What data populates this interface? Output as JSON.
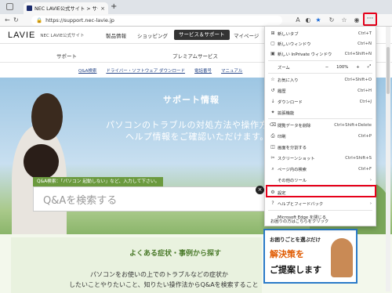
{
  "browser": {
    "tab_title": "NEC LAVIE公式サイト > サービス＆サポ",
    "tab_close": "×",
    "new_tab": "+",
    "url": "https://support.nec-lavie.jp",
    "more": "···"
  },
  "site": {
    "logo": "LAVIE",
    "logo_sub": "NEC LAVIE公式サイト",
    "nav": [
      "製品情報",
      "ショッピング",
      "サービス＆サポート",
      "マイページ"
    ],
    "subnav": [
      "サポート",
      "プレミアムサービス"
    ],
    "links": [
      "Q&A検索",
      "ドライバー・ソフトウェア ダウンロード",
      "電話番号",
      "マニュアル"
    ]
  },
  "hero": {
    "title": "サポート情報",
    "line1": "パソコンのトラブルの対処方法や操作方法な",
    "line2": "ヘルプ情報をご確認いただけます。",
    "qa_hint": "Q&A検索：「パソコン 起動しない」など、入力して下さい。",
    "qa_placeholder": "Q&Aを検索する",
    "close": "×"
  },
  "faq": {
    "title": "よくある症状・事例から探す",
    "body1": "パソコンをお使いの上でのトラブルなどの症状か",
    "body2": "したいことやりたいこと、知りたい操作法からQ&Aを検索すること"
  },
  "banner": {
    "line1": "お困りごとを選ぶだけ",
    "line2": "解決策を",
    "line3": "ご提案します"
  },
  "menu": {
    "items": [
      {
        "label": "新しいタブ",
        "shortcut": "Ctrl+T",
        "icon": "new-tab-icon"
      },
      {
        "label": "新しいウィンドウ",
        "shortcut": "Ctrl+N",
        "icon": "new-window-icon"
      },
      {
        "label": "新しい InPrivate ウィンドウ",
        "shortcut": "Ctrl+Shift+N",
        "icon": "inprivate-icon"
      }
    ],
    "zoom": {
      "label": "ズーム",
      "minus": "−",
      "value": "100%",
      "plus": "+"
    },
    "items2": [
      {
        "label": "お気に入り",
        "shortcut": "Ctrl+Shift+O",
        "icon": "favorites-icon"
      },
      {
        "label": "履歴",
        "shortcut": "Ctrl+H",
        "icon": "history-icon"
      },
      {
        "label": "ダウンロード",
        "shortcut": "Ctrl+J",
        "icon": "download-icon"
      },
      {
        "label": "拡張機能",
        "shortcut": "",
        "icon": "extensions-icon"
      }
    ],
    "items3": [
      {
        "label": "閲覧データを削除",
        "shortcut": "Ctrl+Shift+Delete",
        "icon": "delete-icon"
      },
      {
        "label": "印刷",
        "shortcut": "Ctrl+P",
        "icon": "print-icon"
      },
      {
        "label": "画面を分割する",
        "shortcut": "",
        "icon": "split-icon"
      },
      {
        "label": "スクリーンショット",
        "shortcut": "Ctrl+Shift+S",
        "icon": "screenshot-icon"
      },
      {
        "label": "ページ内の検索",
        "shortcut": "Ctrl+F",
        "icon": "find-icon"
      },
      {
        "label": "その他のツール",
        "shortcut": "",
        "icon": "tools-icon"
      }
    ],
    "settings": {
      "label": "設定",
      "icon": "gear-icon"
    },
    "help": {
      "label": "ヘルプとフィードバック",
      "icon": "help-icon"
    },
    "close_edge": "Microsoft Edge を閉じる",
    "trouble": "お困りの方はこちらをクリック"
  }
}
